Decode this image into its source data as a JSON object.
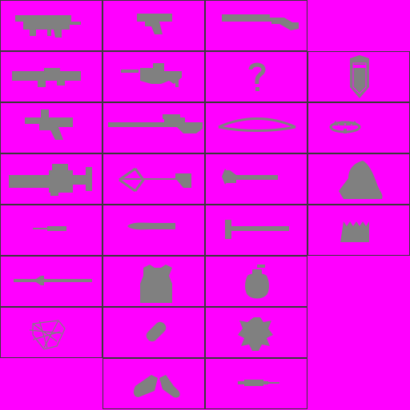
{
  "sheet": {
    "background_color": "#ff00ff",
    "icon_color": "#808080",
    "grid_color": "#3a3a3a",
    "columns": 4,
    "rows": 8
  },
  "icons": [
    [
      "submachine-gun-icon",
      "pistol-icon",
      "shotgun-icon",
      ""
    ],
    [
      "rocket-launcher-icon",
      "flamethrower-icon",
      "unknown-question-icon",
      "shield-icon"
    ],
    [
      "revolver-pistol-icon",
      "sniper-rifle-icon",
      "bow-icon",
      "bear-trap-icon"
    ],
    [
      "minigun-icon",
      "crossbow-icon",
      "axe-icon",
      "ghillie-cloak-icon"
    ],
    [
      "dagger-icon",
      "baton-icon",
      "sledgehammer-icon",
      "spike-trap-icon"
    ],
    [
      "machete-icon",
      "body-armor-vest-icon",
      "frag-grenade-icon",
      ""
    ],
    [
      "net-icon",
      "pill-capsule-icon",
      "turtle-icon",
      ""
    ],
    [
      "",
      "sneakers-icon",
      "syringe-icon",
      ""
    ]
  ]
}
